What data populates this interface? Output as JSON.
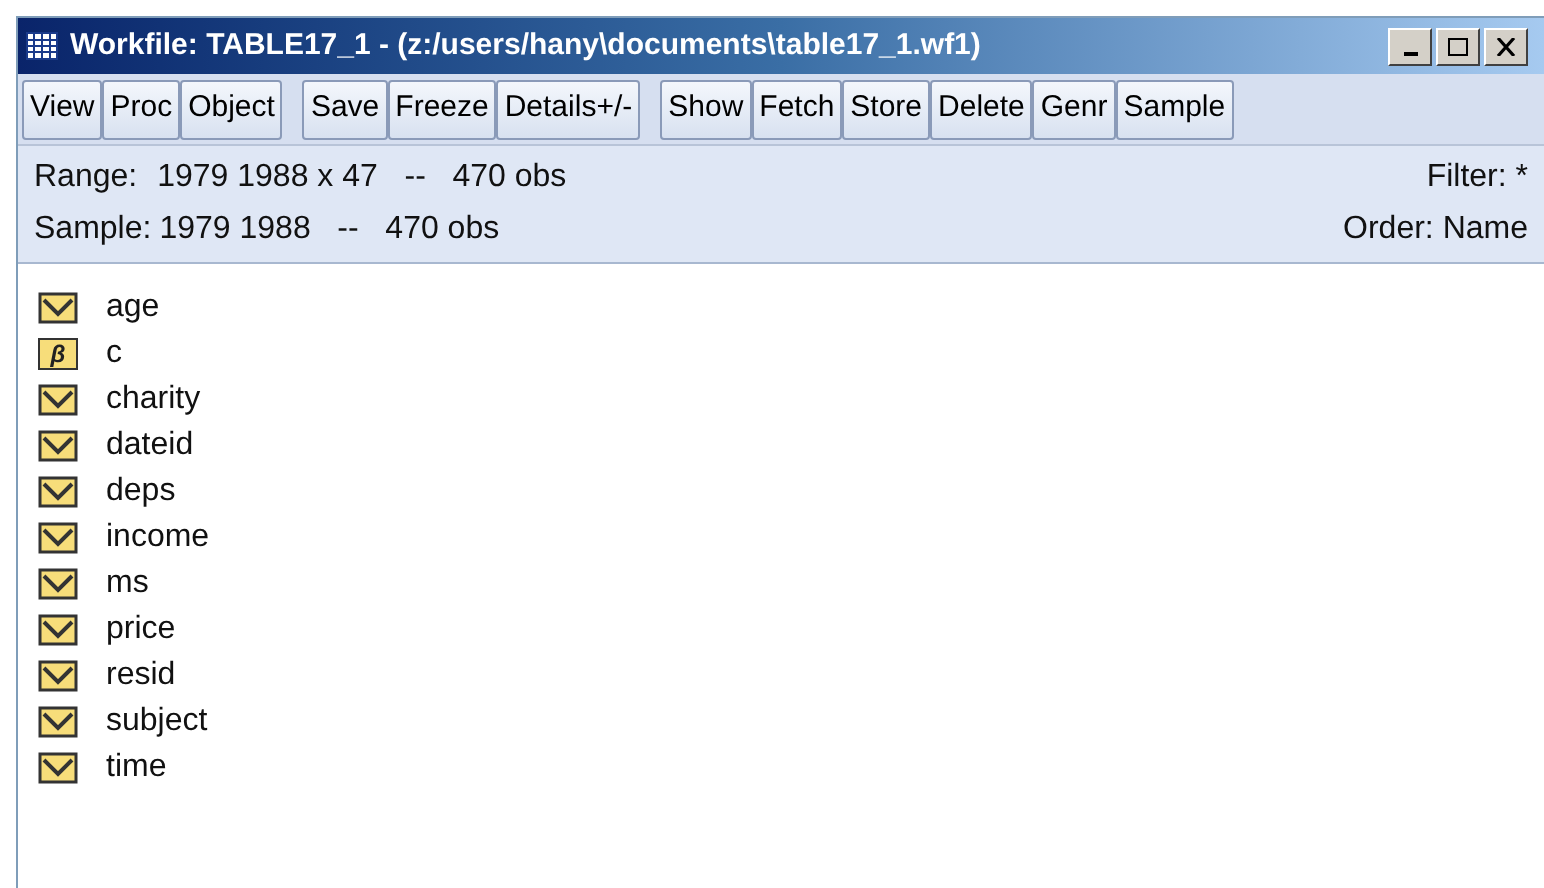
{
  "window": {
    "title": "Workfile: TABLE17_1 - (z:/users/hany\\documents\\table17_1.wf1)"
  },
  "toolbar": {
    "groups": [
      [
        "View",
        "Proc",
        "Object"
      ],
      [
        "Save",
        "Freeze",
        "Details+/-"
      ],
      [
        "Show",
        "Fetch",
        "Store",
        "Delete",
        "Genr",
        "Sample"
      ]
    ]
  },
  "info": {
    "range_label": "Range:",
    "range_value": "1979 1988 x 47   --   470 obs",
    "filter": "Filter: *",
    "sample_label": "Sample:",
    "sample_value": "1979 1988   --   470 obs",
    "order": "Order: Name"
  },
  "objects": [
    {
      "kind": "series",
      "name": "age"
    },
    {
      "kind": "coef",
      "name": "c",
      "glyph": "β"
    },
    {
      "kind": "series",
      "name": "charity"
    },
    {
      "kind": "series",
      "name": "dateid"
    },
    {
      "kind": "series",
      "name": "deps"
    },
    {
      "kind": "series",
      "name": "income"
    },
    {
      "kind": "series",
      "name": "ms"
    },
    {
      "kind": "series",
      "name": "price"
    },
    {
      "kind": "series",
      "name": "resid"
    },
    {
      "kind": "series",
      "name": "subject"
    },
    {
      "kind": "series",
      "name": "time"
    }
  ]
}
